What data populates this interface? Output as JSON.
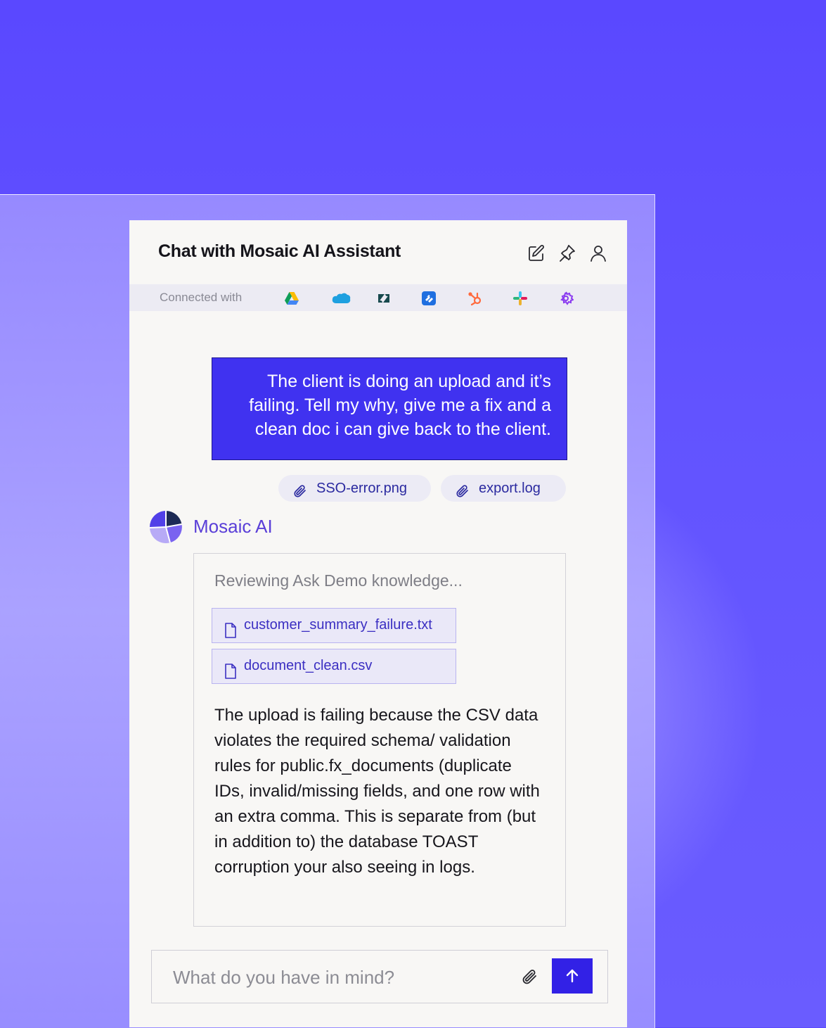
{
  "colors": {
    "background": "#5b4bff",
    "accent": "#3221e6",
    "user_bubble": "#4032f0",
    "ai_name": "#5a3fd8"
  },
  "header": {
    "title": "Chat with Mosaic AI Assistant",
    "icons": [
      "compose-icon",
      "pin-icon",
      "user-icon"
    ]
  },
  "connected": {
    "label": "Connected with",
    "integrations": [
      "google-drive",
      "salesforce",
      "zendesk",
      "jira",
      "hubspot",
      "slack",
      "custom-gear"
    ]
  },
  "conversation": {
    "user_message": "The client is doing an upload and it’s failing. Tell my why, give me a fix and a clean doc i can give back to the client.",
    "attachments": [
      {
        "name": "SSO-error.png"
      },
      {
        "name": "export.log"
      }
    ],
    "assistant": {
      "name": "Mosaic AI",
      "status": "Reviewing Ask Demo knowledge...",
      "files": [
        {
          "name": "customer_summary_failure.txt"
        },
        {
          "name": "document_clean.csv"
        }
      ],
      "response": "The upload is failing because the CSV data violates the required schema/ validation rules for public.fx_documents (duplicate IDs, invalid/missing fields, and one row with an extra comma. This is separate from (but in addition to) the database TOAST corruption your also seeing in logs."
    }
  },
  "composer": {
    "placeholder": "What do you have in mind?",
    "value": ""
  }
}
